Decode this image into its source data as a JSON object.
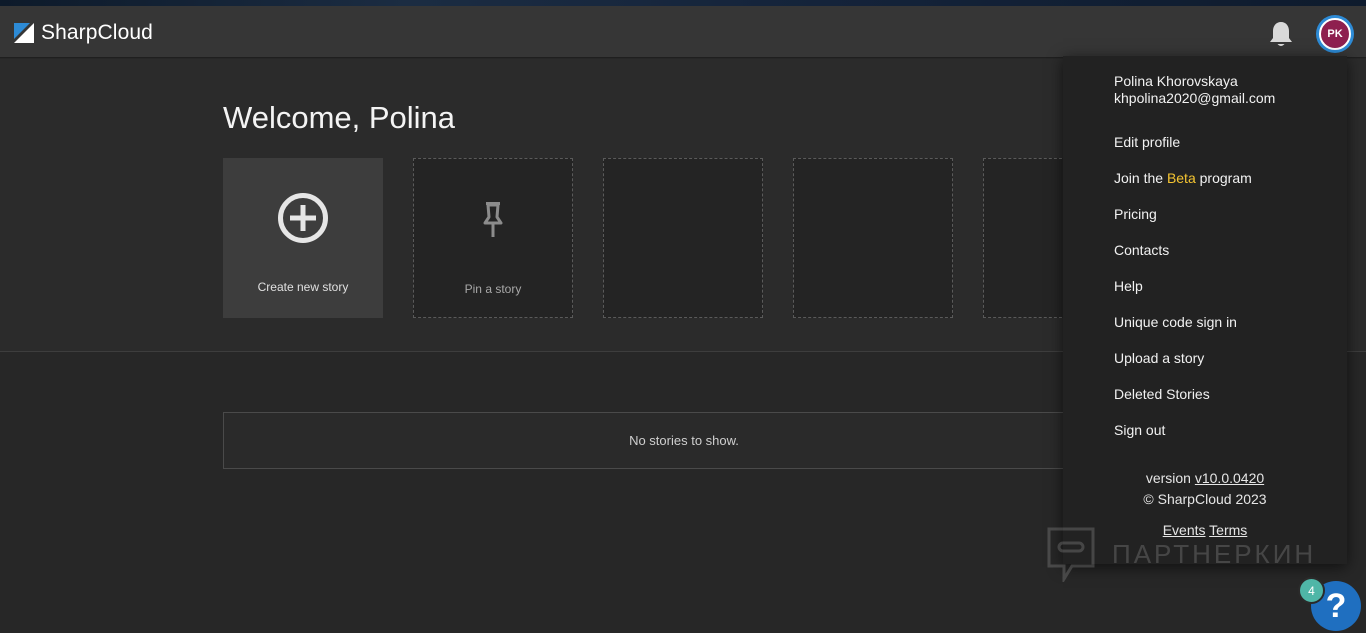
{
  "app": {
    "name": "SharpCloud"
  },
  "header": {
    "bell_icon": "bell-icon",
    "avatar_initials": "PK",
    "colors": {
      "avatar_ring": "#2d8bd6",
      "avatar_fill": "#8e1f4f"
    }
  },
  "main": {
    "welcome": "Welcome, Polina",
    "tiles": [
      {
        "label": "Create new story",
        "icon": "plus-circle-icon"
      },
      {
        "label": "Pin a story",
        "icon": "pin-icon"
      },
      {
        "label": ""
      },
      {
        "label": ""
      },
      {
        "label": ""
      }
    ],
    "empty_message": "No stories to show."
  },
  "menu": {
    "user_name": "Polina Khorovskaya",
    "user_email": "khpolina2020@gmail.com",
    "items": {
      "edit_profile": "Edit profile",
      "join_prefix": "Join the",
      "join_beta": "Beta",
      "join_suffix": "program",
      "pricing": "Pricing",
      "contacts": "Contacts",
      "help": "Help",
      "unique_code": "Unique code sign in",
      "upload": "Upload a story",
      "deleted": "Deleted Stories",
      "sign_out": "Sign out"
    },
    "version_label": "version",
    "version_value": "v10.0.0420",
    "copyright": "© SharpCloud 2023",
    "events": "Events",
    "terms": "Terms"
  },
  "watermark": {
    "text": "ПАРТНЕРКИН"
  },
  "help_widget": {
    "badge_count": "4",
    "symbol": "?"
  }
}
